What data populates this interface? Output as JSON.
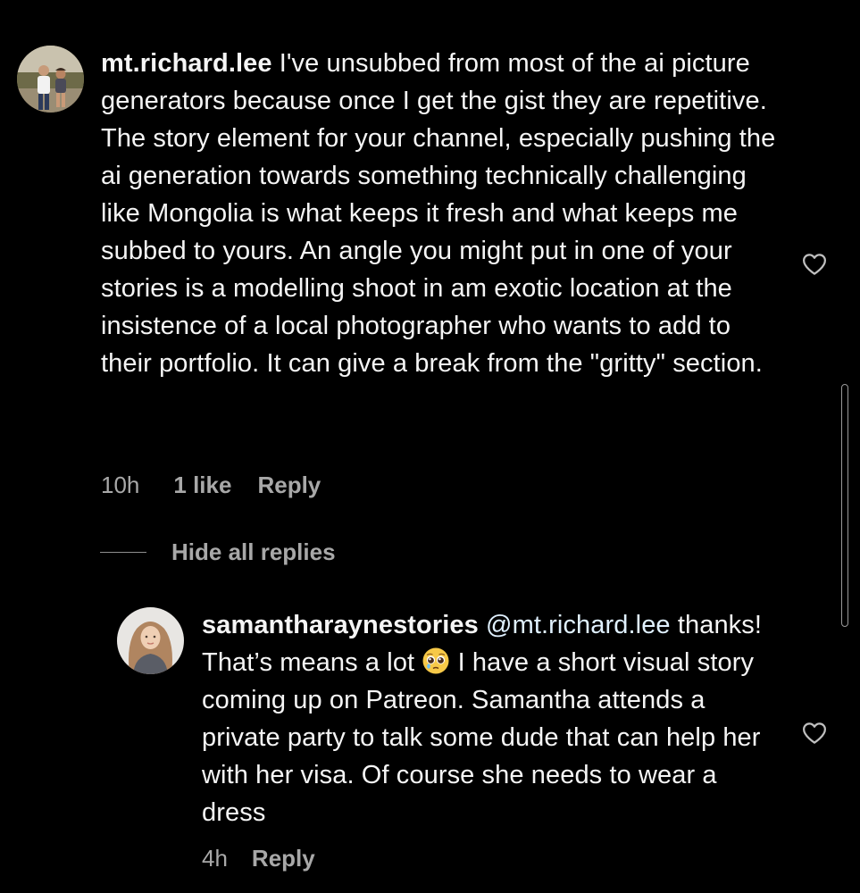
{
  "comment": {
    "username": "mt.richard.lee",
    "text": "I've unsubbed from most of the ai picture generators because once I get the gist they are repetitive. The story element for your channel, especially pushing the ai generation towards something technically challenging like Mongolia is what keeps it fresh and what keeps me subbed to yours. An angle you might put in one of your stories is a modelling shoot in am exotic location at the insistence of a local photographer who wants to add to their portfolio. It can give a break from the \"gritty\" section.",
    "time": "10h",
    "likes": "1 like",
    "reply_label": "Reply",
    "like_icon": "heart-outline-icon"
  },
  "replies_toggle": {
    "label": "Hide all replies"
  },
  "reply": {
    "username": "samantharaynestories",
    "mention": "@mt.richard.lee",
    "text_before_emoji": "thanks! That’s means a lot",
    "emoji": "pleading-face-emoji",
    "text_after_emoji": "I have a short visual story coming up on Patreon. Samantha attends a private party to talk some dude that can help her with her visa. Of course she needs to wear a dress",
    "time": "4h",
    "reply_label": "Reply",
    "like_icon": "heart-outline-icon"
  },
  "colors": {
    "background": "#000000",
    "text": "#f5f5f5",
    "secondary_text": "#a8a8a8",
    "mention": "#e0f1ff"
  }
}
